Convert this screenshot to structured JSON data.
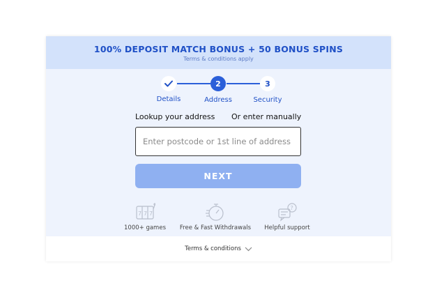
{
  "banner": {
    "title": "100% DEPOSIT MATCH BONUS + 50 BONUS SPINS",
    "subtitle": "Terms & conditions apply"
  },
  "stepper": {
    "steps": [
      {
        "number": "✓",
        "label": "Details",
        "state": "done"
      },
      {
        "number": "2",
        "label": "Address",
        "state": "active"
      },
      {
        "number": "3",
        "label": "Security",
        "state": "pending"
      }
    ]
  },
  "address": {
    "lookup_label": "Lookup your address",
    "manual_label": "Or enter manually",
    "placeholder": "Enter postcode or 1st line of address",
    "value": ""
  },
  "next_button": {
    "label": "NEXT"
  },
  "features": [
    {
      "label": "1000+ games",
      "icon": "slot-machine-icon"
    },
    {
      "label": "Free & Fast Withdrawals",
      "icon": "stopwatch-icon"
    },
    {
      "label": "Helpful support",
      "icon": "support-chat-icon"
    }
  ],
  "terms": {
    "label": "Terms & conditions"
  },
  "colors": {
    "brand": "#1f50c6",
    "banner_bg": "#d3e2fb",
    "card_bg": "#eef3fd",
    "button_disabled": "#8fb0f1"
  }
}
